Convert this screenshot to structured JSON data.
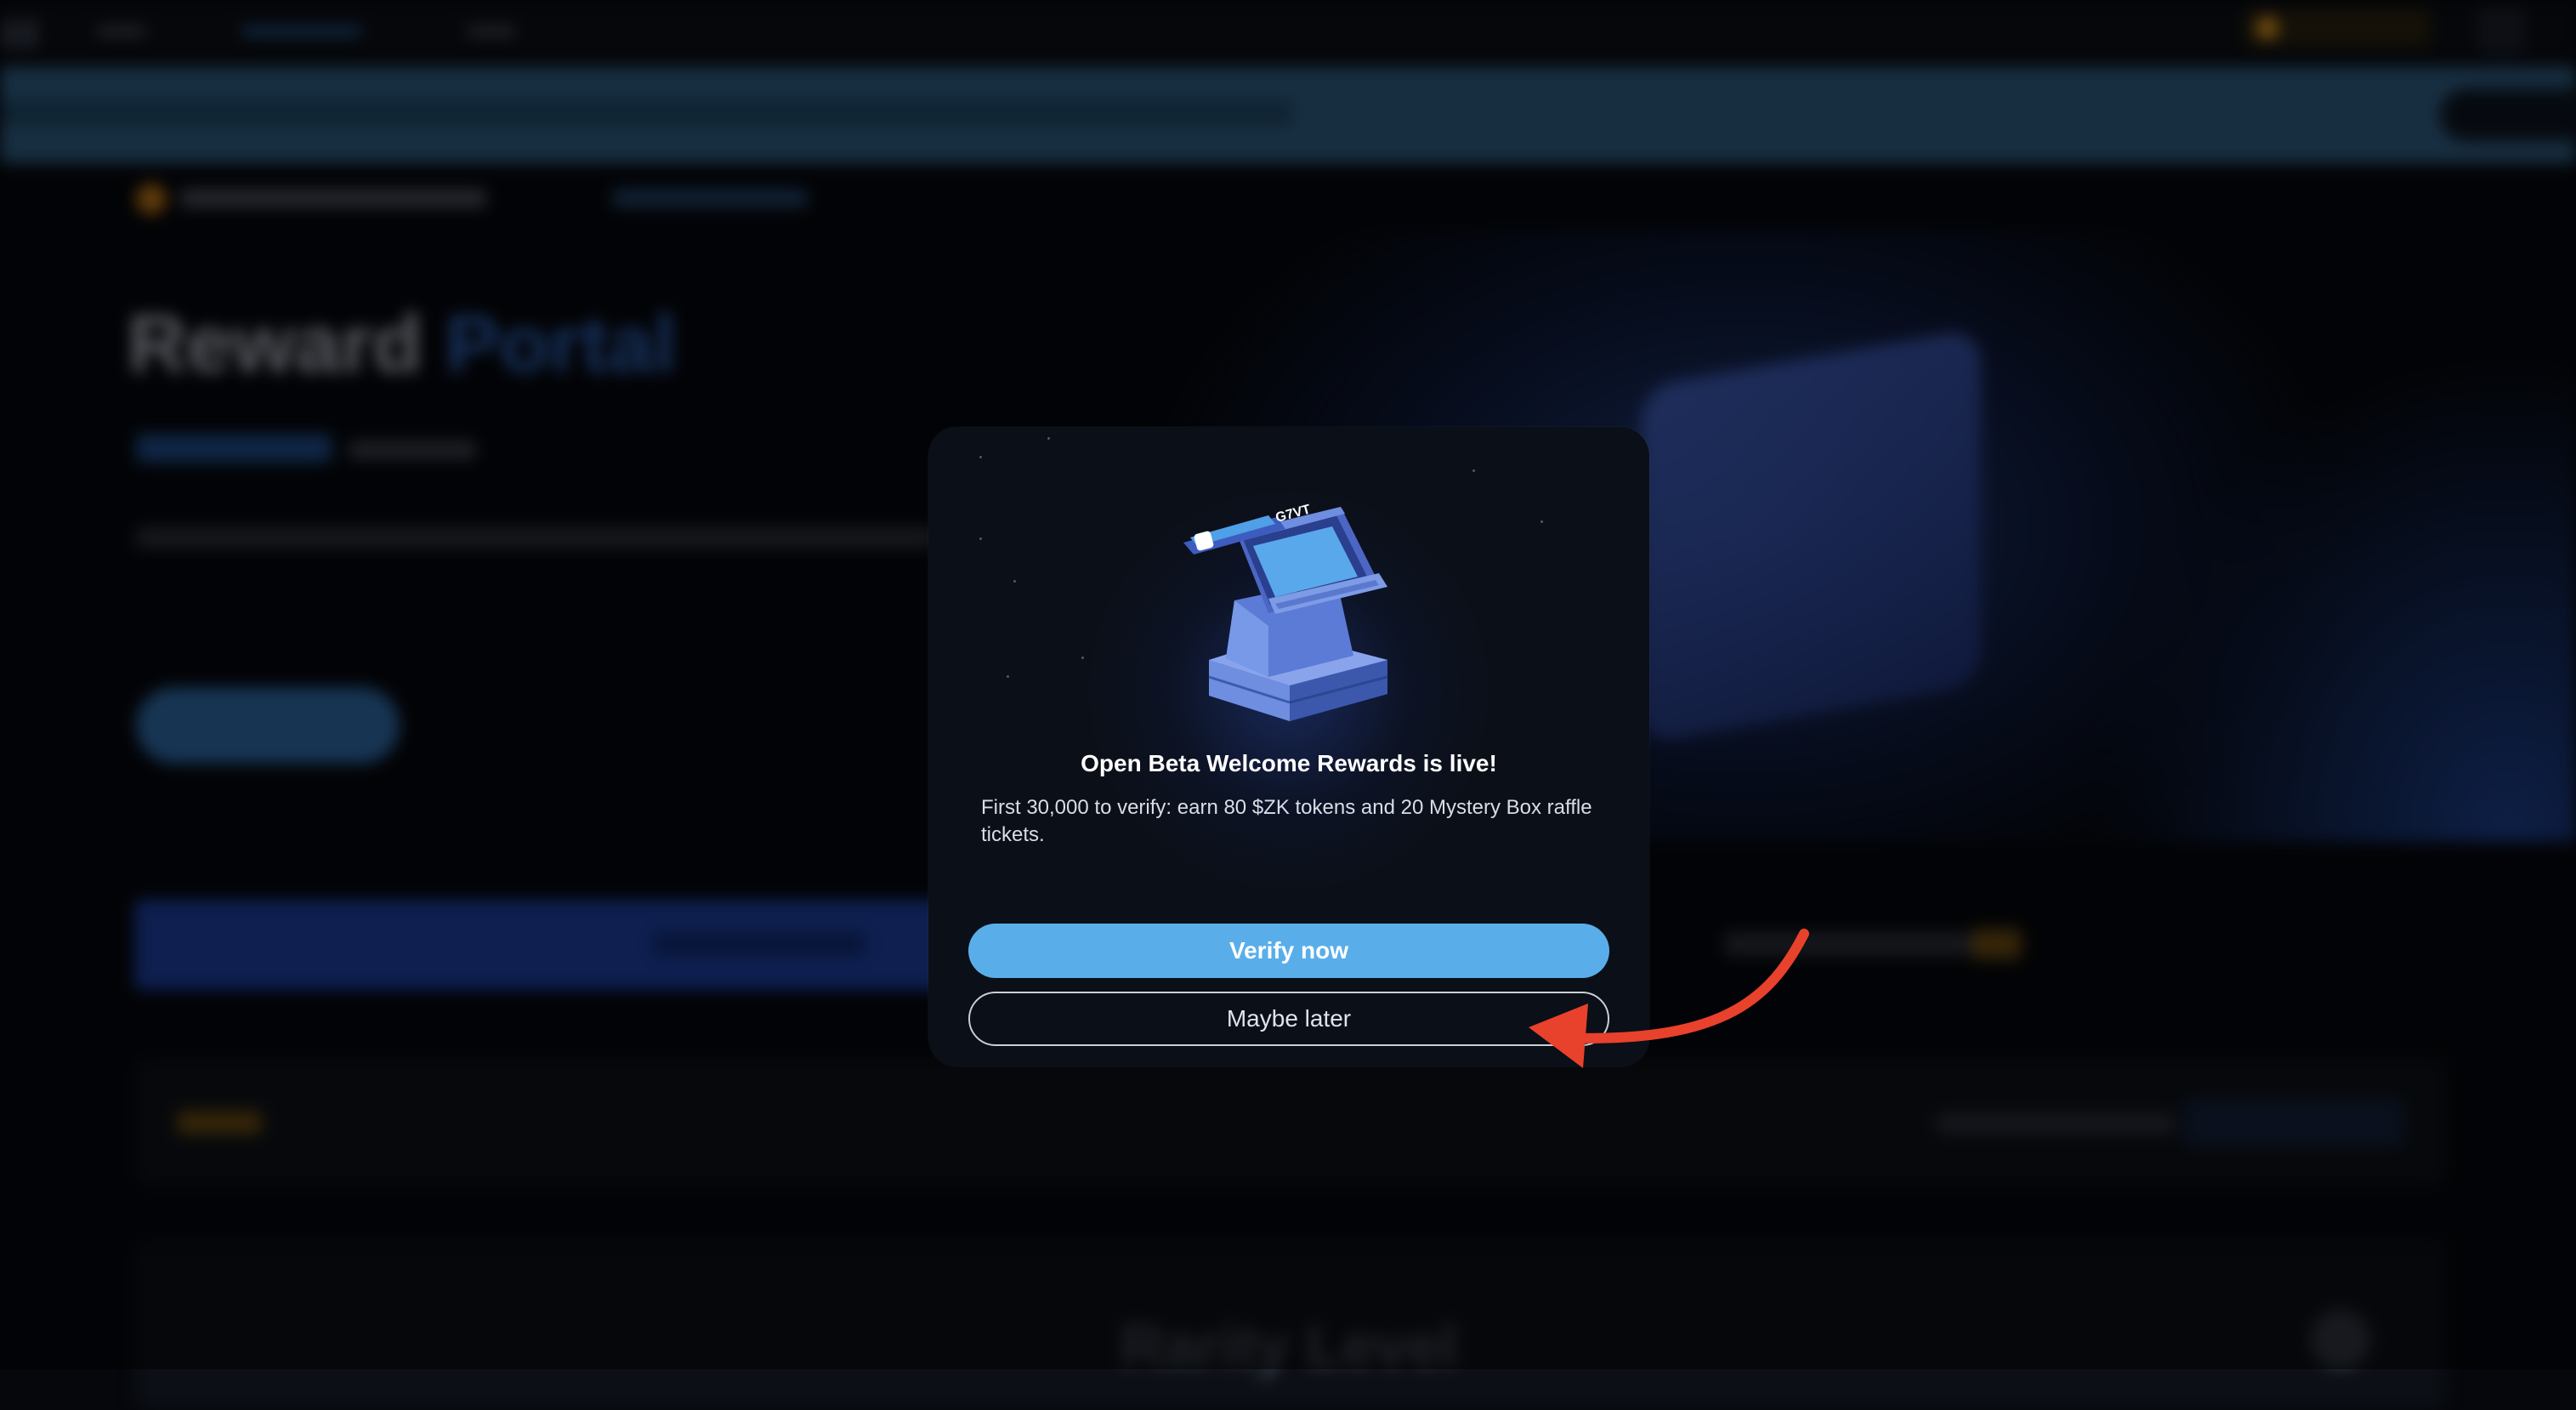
{
  "modal": {
    "title": "Open Beta Welcome Rewards is live!",
    "description": "First 30,000 to verify: earn 80 $ZK tokens and 20 Mystery Box raffle tickets.",
    "primary_button": "Verify now",
    "secondary_button": "Maybe later",
    "illustration_label": "G7VT",
    "illustration_icon": "voucher-machine-icon"
  },
  "background": {
    "heading_part1": "Reward",
    "heading_part2": "Portal",
    "section_heading": "Rarity Level"
  },
  "annotation": {
    "arrow_color": "#e8412c",
    "points_to": "secondary_button"
  },
  "colors": {
    "accent": "#59aeea",
    "modal_bg": "#0b0f17",
    "brand_blue": "#2f63b8",
    "coin": "#f0a020"
  }
}
